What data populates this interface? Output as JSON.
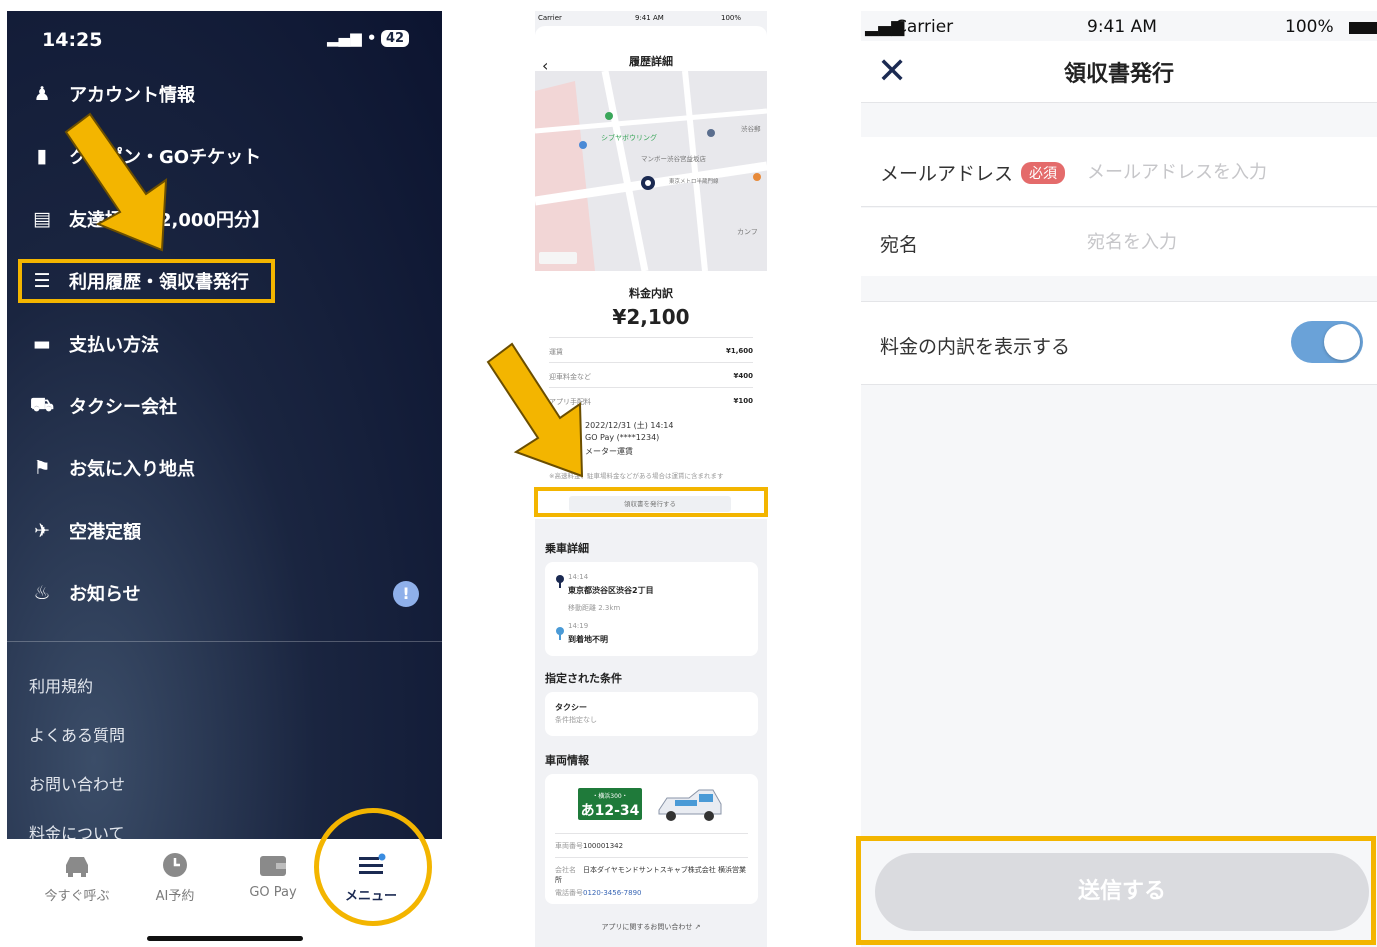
{
  "panel1": {
    "status": {
      "time": "14:25",
      "signal": "▂▄▆ •",
      "battery": "42"
    },
    "menu_items": [
      {
        "icon": "user-icon",
        "label": "アカウント情報"
      },
      {
        "icon": "ticket-icon",
        "label": "クーポン・GOチケット"
      },
      {
        "icon": "gift-icon",
        "label": "友達招待【2,000円分】"
      },
      {
        "icon": "list-icon",
        "label": "利用履歴・領収書発行"
      },
      {
        "icon": "card-icon",
        "label": "支払い方法"
      },
      {
        "icon": "car-icon",
        "label": "タクシー会社"
      },
      {
        "icon": "flag-icon",
        "label": "お気に入り地点"
      },
      {
        "icon": "plane-icon",
        "label": "空港定額"
      },
      {
        "icon": "bell-icon",
        "label": "お知らせ"
      }
    ],
    "notification_badge": "!",
    "sub_items": [
      "利用規約",
      "よくある質問",
      "お問い合わせ",
      "料金について"
    ],
    "tabs": [
      "今すぐ呼ぶ",
      "AI予約",
      "GO Pay",
      "メニュー"
    ]
  },
  "panel2": {
    "status": {
      "carrier": "Carrier",
      "time": "9:41 AM",
      "battery": "100%"
    },
    "title": "履歴詳細",
    "map_labels": [
      "シブヤボウリング",
      "マンボー渋谷宮益坂店",
      "東京メトロ半蔵門線",
      "渋谷郵",
      "カンフ"
    ],
    "fare_title": "料金内訳",
    "fare_total": "¥2,100",
    "fare_rows": [
      {
        "label": "運賃",
        "value": "¥1,600"
      },
      {
        "label": "迎車料金など",
        "value": "¥400"
      },
      {
        "label": "アプリ手配料",
        "value": "¥100"
      }
    ],
    "ride_date": "2022/12/31 (土) 14:14",
    "payment": "GO Pay (****1234)",
    "fare_type": "メーター運賃",
    "note": "※高速料金、駐車場料金などがある場合は運賃に含まれます",
    "receipt_button": "領収書を発行する",
    "ride_detail_title": "乗車詳細",
    "pickup_time": "14:14",
    "pickup_address": "東京都渋谷区渋谷2丁目",
    "distance": "移動距離 2.3km",
    "dropoff_time": "14:19",
    "dropoff_address": "到着地不明",
    "conditions_title": "指定された条件",
    "condition_name": "タクシー",
    "condition_detail": "条件指定なし",
    "vehicle_title": "車両情報",
    "plate_top": "・横浜300・",
    "plate_number": "あ12-34",
    "vehicle_number_label": "車両番号",
    "vehicle_number": "100001342",
    "company_label": "会社名",
    "company": "日本ダイヤモンドサントスキャブ株式会社 横浜営業所",
    "phone_label": "電話番号",
    "phone": "0120-3456-7890",
    "contact_link": "アプリに関するお問い合わせ"
  },
  "panel3": {
    "status": {
      "carrier": "Carrier",
      "time": "9:41 AM",
      "battery": "100%"
    },
    "title": "領収書発行",
    "email_label": "メールアドレス",
    "required_badge": "必須",
    "email_placeholder": "メールアドレスを入力",
    "name_label": "宛名",
    "name_placeholder": "宛名を入力",
    "breakdown_label": "料金の内訳を表示する",
    "breakdown_toggle": "on",
    "send_button": "送信する"
  },
  "colors": {
    "highlight": "#f3b500",
    "menu_bg": "#1a2540",
    "toggle_on": "#6aa2d8",
    "plate_green": "#1f7a3a"
  }
}
